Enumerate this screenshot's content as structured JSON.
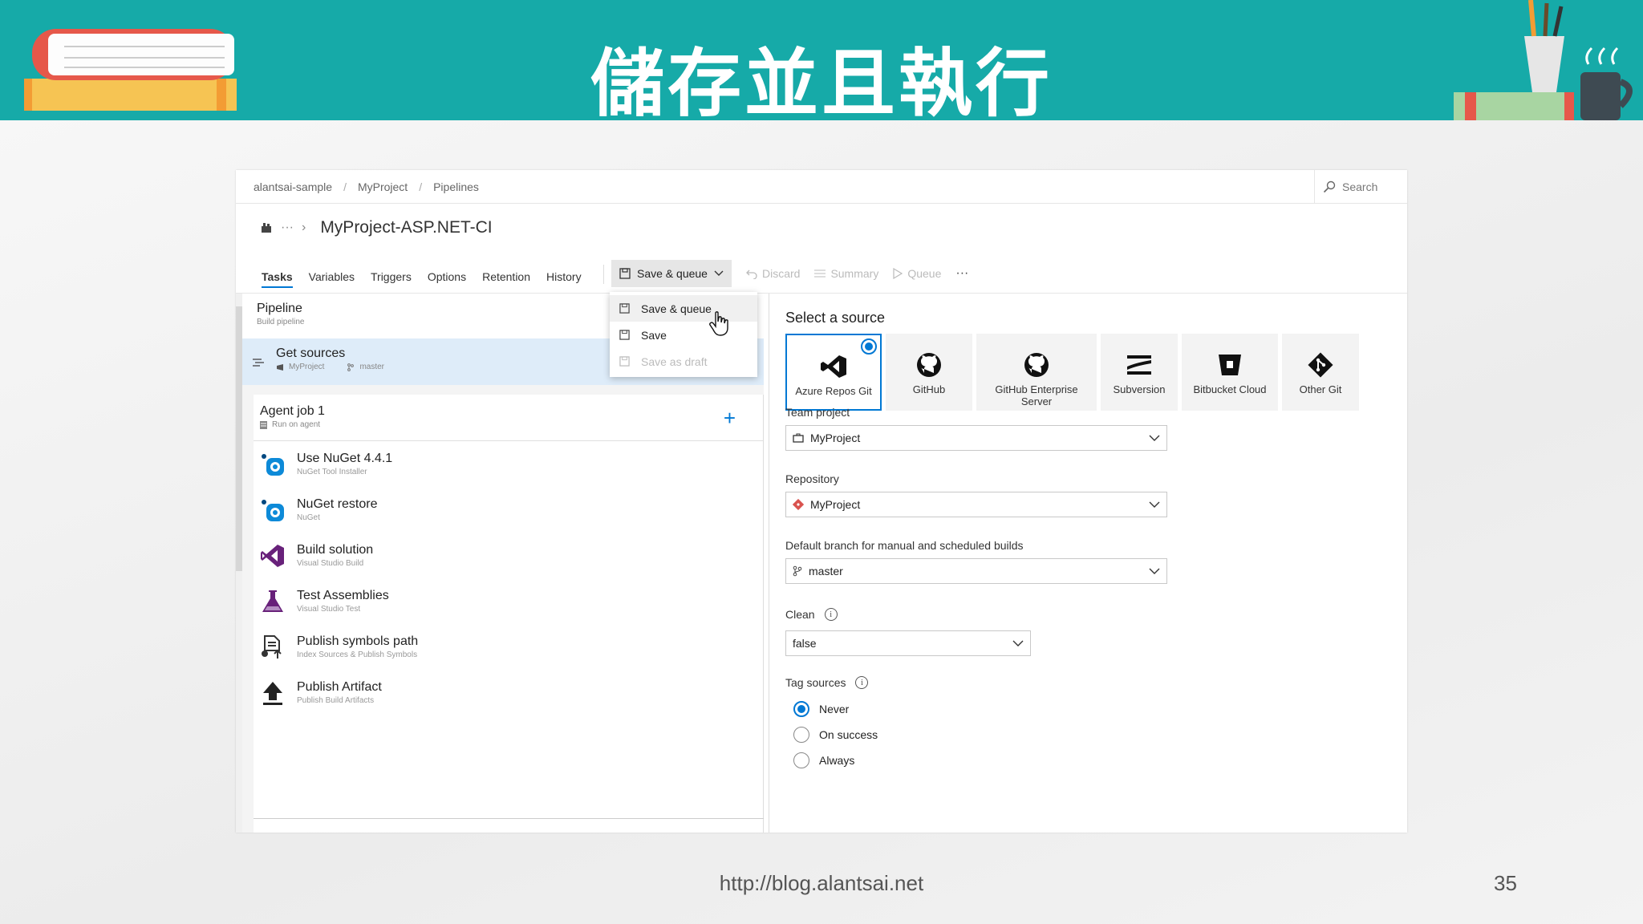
{
  "slide": {
    "title": "儲存並且執行",
    "footer_url": "http://blog.alantsai.net",
    "page_number": "35"
  },
  "breadcrumb": [
    "alantsai-sample",
    "MyProject",
    "Pipelines"
  ],
  "search": {
    "label": "Search"
  },
  "pipeline": {
    "title": "MyProject-ASP.NET-CI",
    "more": "···",
    "chevron": "›"
  },
  "tabs": [
    "Tasks",
    "Variables",
    "Triggers",
    "Options",
    "Retention",
    "History"
  ],
  "toolbar": {
    "save_queue": "Save & queue",
    "discard": "Discard",
    "summary": "Summary",
    "queue": "Queue",
    "more": "···"
  },
  "save_menu": {
    "items": [
      {
        "label": "Save & queue",
        "state": "hover"
      },
      {
        "label": "Save",
        "state": "normal"
      },
      {
        "label": "Save as draft",
        "state": "disabled"
      }
    ]
  },
  "tree": {
    "pipeline": {
      "title": "Pipeline",
      "subtitle": "Build pipeline"
    },
    "get_sources": {
      "title": "Get sources",
      "repo": "MyProject",
      "branch": "master"
    },
    "agent_job": {
      "title": "Agent job 1",
      "subtitle": "Run on agent"
    },
    "tasks": [
      {
        "title": "Use NuGet 4.4.1",
        "subtitle": "NuGet Tool Installer",
        "icon": "nuget-icon"
      },
      {
        "title": "NuGet restore",
        "subtitle": "NuGet",
        "icon": "nuget-icon"
      },
      {
        "title": "Build solution",
        "subtitle": "Visual Studio Build",
        "icon": "visual-studio-icon"
      },
      {
        "title": "Test Assemblies",
        "subtitle": "Visual Studio Test",
        "icon": "flask-icon"
      },
      {
        "title": "Publish symbols path",
        "subtitle": "Index Sources & Publish Symbols",
        "icon": "publish-symbols-icon"
      },
      {
        "title": "Publish Artifact",
        "subtitle": "Publish Build Artifacts",
        "icon": "upload-icon"
      }
    ]
  },
  "source": {
    "heading": "Select a source",
    "options": [
      {
        "label": "Azure Repos Git",
        "selected": true,
        "icon": "azure-repos-icon"
      },
      {
        "label": "GitHub",
        "selected": false,
        "icon": "github-icon"
      },
      {
        "label": "GitHub Enterprise Server",
        "selected": false,
        "icon": "github-icon"
      },
      {
        "label": "Subversion",
        "selected": false,
        "icon": "subversion-icon"
      },
      {
        "label": "Bitbucket Cloud",
        "selected": false,
        "icon": "bitbucket-icon"
      },
      {
        "label": "Other Git",
        "selected": false,
        "icon": "git-icon"
      }
    ],
    "team_project": {
      "label": "Team project",
      "value": "MyProject"
    },
    "repository": {
      "label": "Repository",
      "value": "MyProject"
    },
    "default_branch": {
      "label": "Default branch for manual and scheduled builds",
      "value": "master"
    },
    "clean": {
      "label": "Clean",
      "value": "false"
    },
    "tag_sources": {
      "label": "Tag sources",
      "options": [
        {
          "label": "Never",
          "checked": true
        },
        {
          "label": "On success",
          "checked": false
        },
        {
          "label": "Always",
          "checked": false
        }
      ]
    }
  },
  "colors": {
    "banner": "#16aaa8",
    "accent": "#0078d4",
    "selection": "#deecf9"
  }
}
